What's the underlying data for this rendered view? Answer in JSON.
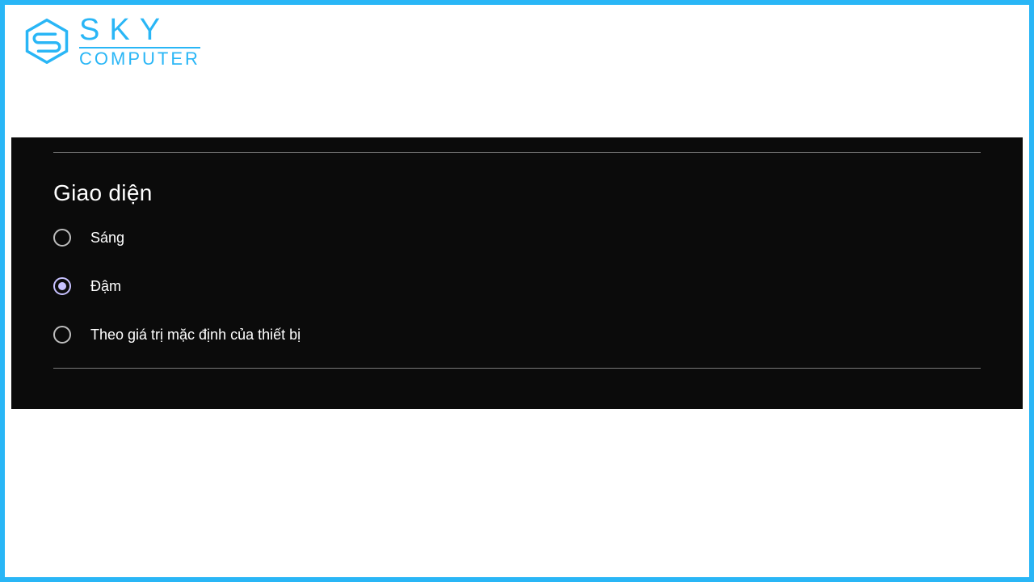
{
  "branding": {
    "logo_top": "SKY",
    "logo_bottom": "COMPUTER",
    "accent_color": "#29b6f6"
  },
  "settings": {
    "section_title": "Giao diện",
    "options": [
      {
        "label": "Sáng",
        "selected": false
      },
      {
        "label": "Đậm",
        "selected": true
      },
      {
        "label": "Theo giá trị mặc định của thiết bị",
        "selected": false
      }
    ]
  }
}
